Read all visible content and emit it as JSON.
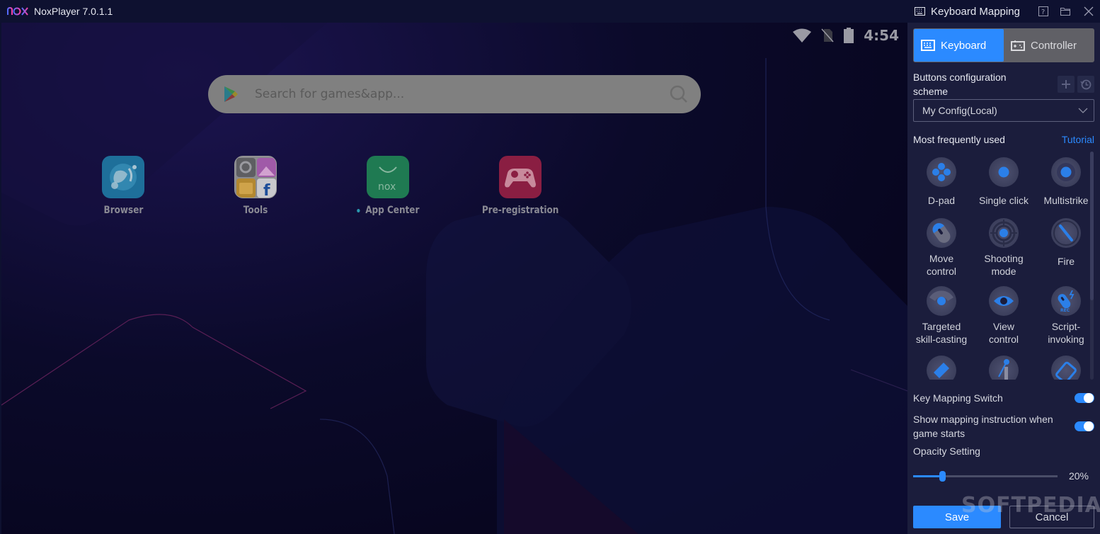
{
  "window": {
    "app_title": "NoxPlayer 7.0.1.1",
    "logo_text": "nox"
  },
  "android": {
    "status": {
      "time": "4:54",
      "icons": [
        "wifi-icon",
        "no-sim-icon",
        "battery-icon"
      ]
    },
    "search": {
      "placeholder": "Search for games&app..."
    },
    "apps": [
      {
        "label": "Browser",
        "icon": "browser-icon"
      },
      {
        "label": "Tools",
        "icon": "tools-folder-icon"
      },
      {
        "label": "App Center",
        "icon": "app-center-icon",
        "has_new_dot": true
      },
      {
        "label": "Pre-registration",
        "icon": "gamepad-icon"
      }
    ]
  },
  "panel": {
    "title": "Keyboard Mapping",
    "header_icons": [
      "help-icon",
      "folder-icon",
      "close-icon"
    ],
    "tabs": [
      {
        "label": "Keyboard",
        "active": true
      },
      {
        "label": "Controller",
        "active": false
      }
    ],
    "scheme": {
      "label": "Buttons configuration scheme",
      "selected": "My Config(Local)"
    },
    "frequently_used": {
      "label": "Most frequently used",
      "tutorial_link": "Tutorial",
      "tools": [
        {
          "label": "D-pad",
          "icon": "dpad-icon"
        },
        {
          "label": "Single click",
          "icon": "single-click-icon"
        },
        {
          "label": "Multistrike",
          "icon": "multistrike-icon"
        },
        {
          "label": "Move\ncontrol",
          "icon": "move-control-icon"
        },
        {
          "label": "Shooting\nmode",
          "icon": "shooting-mode-icon"
        },
        {
          "label": "Fire",
          "icon": "fire-icon"
        },
        {
          "label": "Targeted\nskill-casting",
          "icon": "targeted-skill-icon"
        },
        {
          "label": "View\ncontrol",
          "icon": "view-control-icon"
        },
        {
          "label": "Script-\ninvoking",
          "icon": "script-invoking-icon"
        },
        {
          "label": "",
          "icon": "tool-10-icon"
        },
        {
          "label": "",
          "icon": "tool-11-icon"
        },
        {
          "label": "",
          "icon": "tool-12-icon"
        }
      ]
    },
    "settings": {
      "key_mapping_switch": {
        "label": "Key Mapping Switch",
        "on": true
      },
      "show_instruction": {
        "label": "Show mapping instruction when game starts",
        "on": true
      },
      "opacity": {
        "label": "Opacity Setting",
        "value_percent": 20,
        "value_text": "20%"
      }
    },
    "buttons": {
      "save": "Save",
      "cancel": "Cancel"
    },
    "accent_color": "#2b8aff"
  },
  "watermark": "SOFTPEDIA"
}
